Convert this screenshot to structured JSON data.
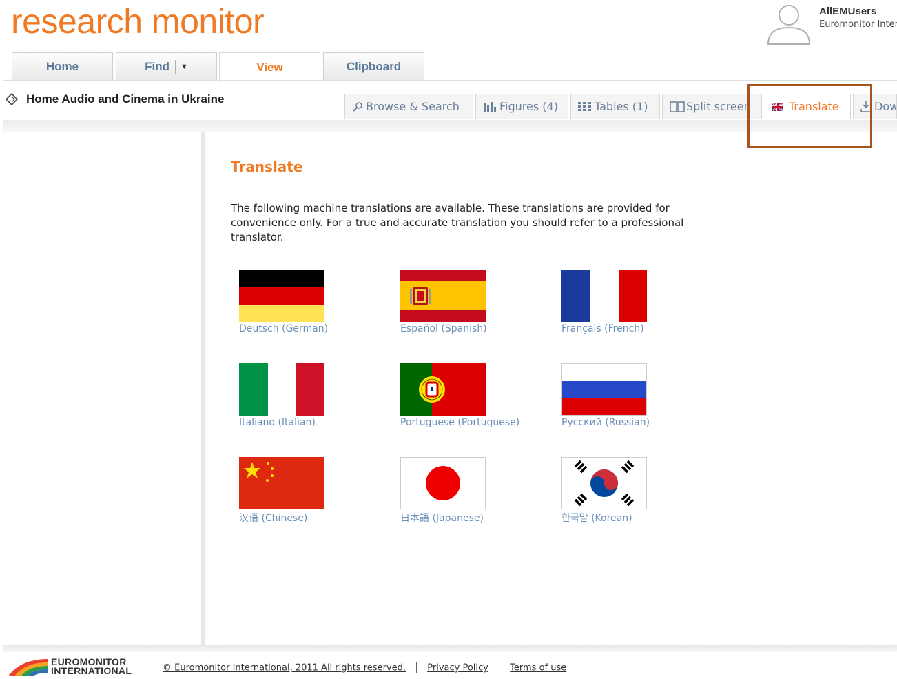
{
  "header": {
    "logo_text": "research monitor",
    "user": {
      "name": "AllEMUsers",
      "org": "Euromonitor International"
    }
  },
  "main_tabs": [
    {
      "label": "Home"
    },
    {
      "label": "Find"
    },
    {
      "label": "View"
    },
    {
      "label": "Clipboard"
    }
  ],
  "document": {
    "title": "Home Audio and Cinema in Ukraine"
  },
  "sub_tabs": [
    {
      "label": "Browse & Search",
      "icon": "search-icon"
    },
    {
      "label": "Figures (4)",
      "icon": "bar-chart-icon"
    },
    {
      "label": "Tables (1)",
      "icon": "table-icon"
    },
    {
      "label": "Split screen",
      "icon": "split-screen-icon"
    },
    {
      "label": "Translate",
      "icon": "uk-flag-icon"
    },
    {
      "label": "Download",
      "icon": "download-icon"
    }
  ],
  "translate": {
    "heading": "Translate",
    "intro": "The following machine translations are available. These translations are provided for convenience only. For a true and accurate translation you should refer to a professional translator.",
    "languages": [
      {
        "label": "Deutsch (German)",
        "flag": "german-flag-icon"
      },
      {
        "label": "Español (Spanish)",
        "flag": "spanish-flag-icon"
      },
      {
        "label": "Français (French)",
        "flag": "french-flag-icon"
      },
      {
        "label": "Italiano (Italian)",
        "flag": "italian-flag-icon"
      },
      {
        "label": "Portuguese (Portuguese)",
        "flag": "portuguese-flag-icon"
      },
      {
        "label": "Русский (Russian)",
        "flag": "russian-flag-icon"
      },
      {
        "label": "汉语 (Chinese)",
        "flag": "chinese-flag-icon"
      },
      {
        "label": "日本語 (Japanese)",
        "flag": "japanese-flag-icon"
      },
      {
        "label": "한국말 (Korean)",
        "flag": "korean-flag-icon"
      }
    ]
  },
  "footer": {
    "logo_line1": "EUROMONITOR",
    "logo_line2": "INTERNATIONAL",
    "copyright": "© Euromonitor International, 2011 All rights reserved.",
    "privacy": "Privacy Policy",
    "terms": "Terms of use"
  },
  "colors": {
    "accent": "#f07a23",
    "link": "#6a8fb8",
    "highlight": "#a5541e"
  }
}
